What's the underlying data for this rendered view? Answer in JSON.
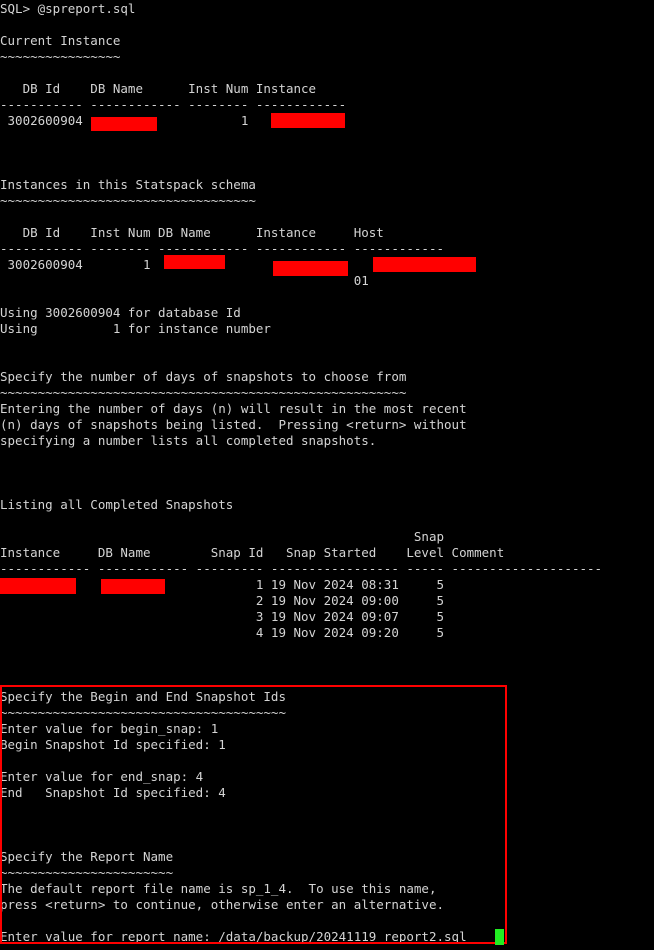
{
  "terminal": {
    "lines": [
      "SQL> @spreport.sql",
      "",
      "Current Instance",
      "~~~~~~~~~~~~~~~~",
      "",
      "   DB Id    DB Name      Inst Num Instance",
      "----------- ------------ -------- ------------",
      " 3002600904                     1",
      "",
      "",
      "",
      "Instances in this Statspack schema",
      "~~~~~~~~~~~~~~~~~~~~~~~~~~~~~~~~~~",
      "",
      "   DB Id    Inst Num DB Name      Instance     Host",
      "----------- -------- ------------ ------------ ------------",
      " 3002600904        1",
      "                                               01",
      "",
      "Using 3002600904 for database Id",
      "Using          1 for instance number",
      "",
      "",
      "Specify the number of days of snapshots to choose from",
      "~~~~~~~~~~~~~~~~~~~~~~~~~~~~~~~~~~~~~~~~~~~~~~~~~~~~~~",
      "Entering the number of days (n) will result in the most recent",
      "(n) days of snapshots being listed.  Pressing <return> without",
      "specifying a number lists all completed snapshots.",
      "",
      "",
      "",
      "Listing all Completed Snapshots",
      "",
      "                                                       Snap",
      "Instance     DB Name        Snap Id   Snap Started    Level Comment",
      "------------ ------------ --------- ----------------- ----- --------------------",
      "                                  1 19 Nov 2024 08:31     5",
      "                                  2 19 Nov 2024 09:00     5",
      "                                  3 19 Nov 2024 09:07     5",
      "                                  4 19 Nov 2024 09:20     5",
      "",
      "",
      "",
      "Specify the Begin and End Snapshot Ids",
      "~~~~~~~~~~~~~~~~~~~~~~~~~~~~~~~~~~~~~~",
      "Enter value for begin_snap: 1",
      "Begin Snapshot Id specified: 1",
      "",
      "Enter value for end_snap: 4",
      "End   Snapshot Id specified: 4",
      "",
      "",
      "",
      "Specify the Report Name",
      "~~~~~~~~~~~~~~~~~~~~~~~",
      "The default report file name is sp_1_4.  To use this name,",
      "press <return> to continue, otherwise enter an alternative.",
      "",
      "Enter value for report_name: /data/backup/20241119_report2.sql"
    ]
  },
  "colors": {
    "background": "#000000",
    "text": "#d4d4d4",
    "redaction": "#ff0000",
    "highlight_border": "#ff0000",
    "cursor": "#22ee22"
  }
}
